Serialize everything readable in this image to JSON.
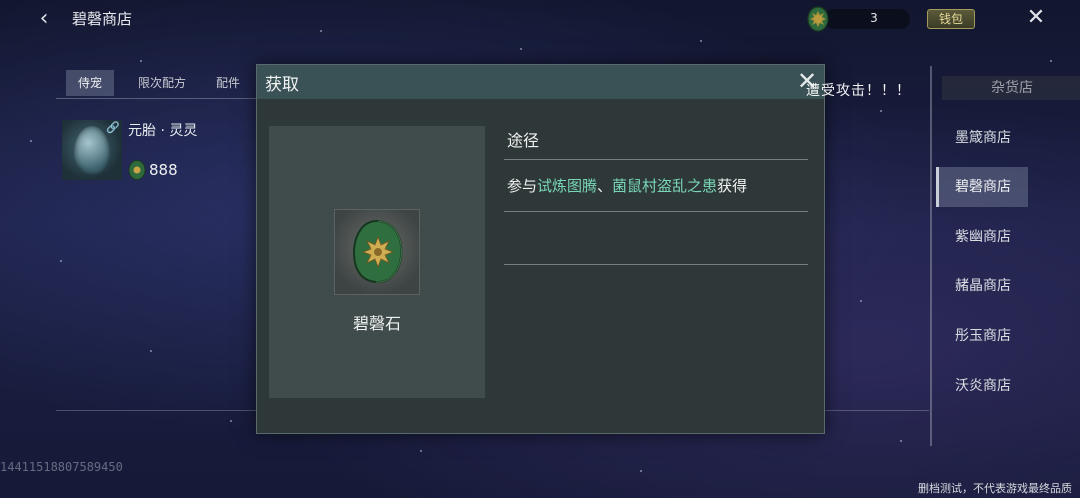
{
  "header": {
    "title": "碧磬商店",
    "currency_count": "3",
    "wallet_label": "钱包"
  },
  "tabs": [
    {
      "label": "侍宠",
      "active": true
    },
    {
      "label": "限次配方",
      "active": false
    },
    {
      "label": "配件",
      "active": false
    }
  ],
  "items": [
    {
      "name": "元胎 · 灵灵",
      "price": "888",
      "icon": "egg-icon"
    }
  ],
  "shops": {
    "header": "杂货店",
    "list": [
      {
        "label": "墨箴商店",
        "active": false
      },
      {
        "label": "碧磬商店",
        "active": true
      },
      {
        "label": "紫幽商店",
        "active": false
      },
      {
        "label": "赭晶商店",
        "active": false
      },
      {
        "label": "彤玉商店",
        "active": false
      },
      {
        "label": "沃炎商店",
        "active": false
      }
    ]
  },
  "notice": "遭受攻击！！！",
  "debug_id": "14411518807589450",
  "footer_note": "删档测试，不代表游戏最终品质",
  "modal": {
    "title": "获取",
    "item_name": "碧磬石",
    "source_label": "途径",
    "source_prefix": "参与",
    "source_link1": "试炼图腾",
    "source_sep": "、",
    "source_link2": "菌鼠村盗乱之患",
    "source_suffix": "获得"
  },
  "colors": {
    "accent_link": "#79d6b8",
    "modal_header": "#3a5256",
    "wallet_gold": "#e9dc9a"
  }
}
